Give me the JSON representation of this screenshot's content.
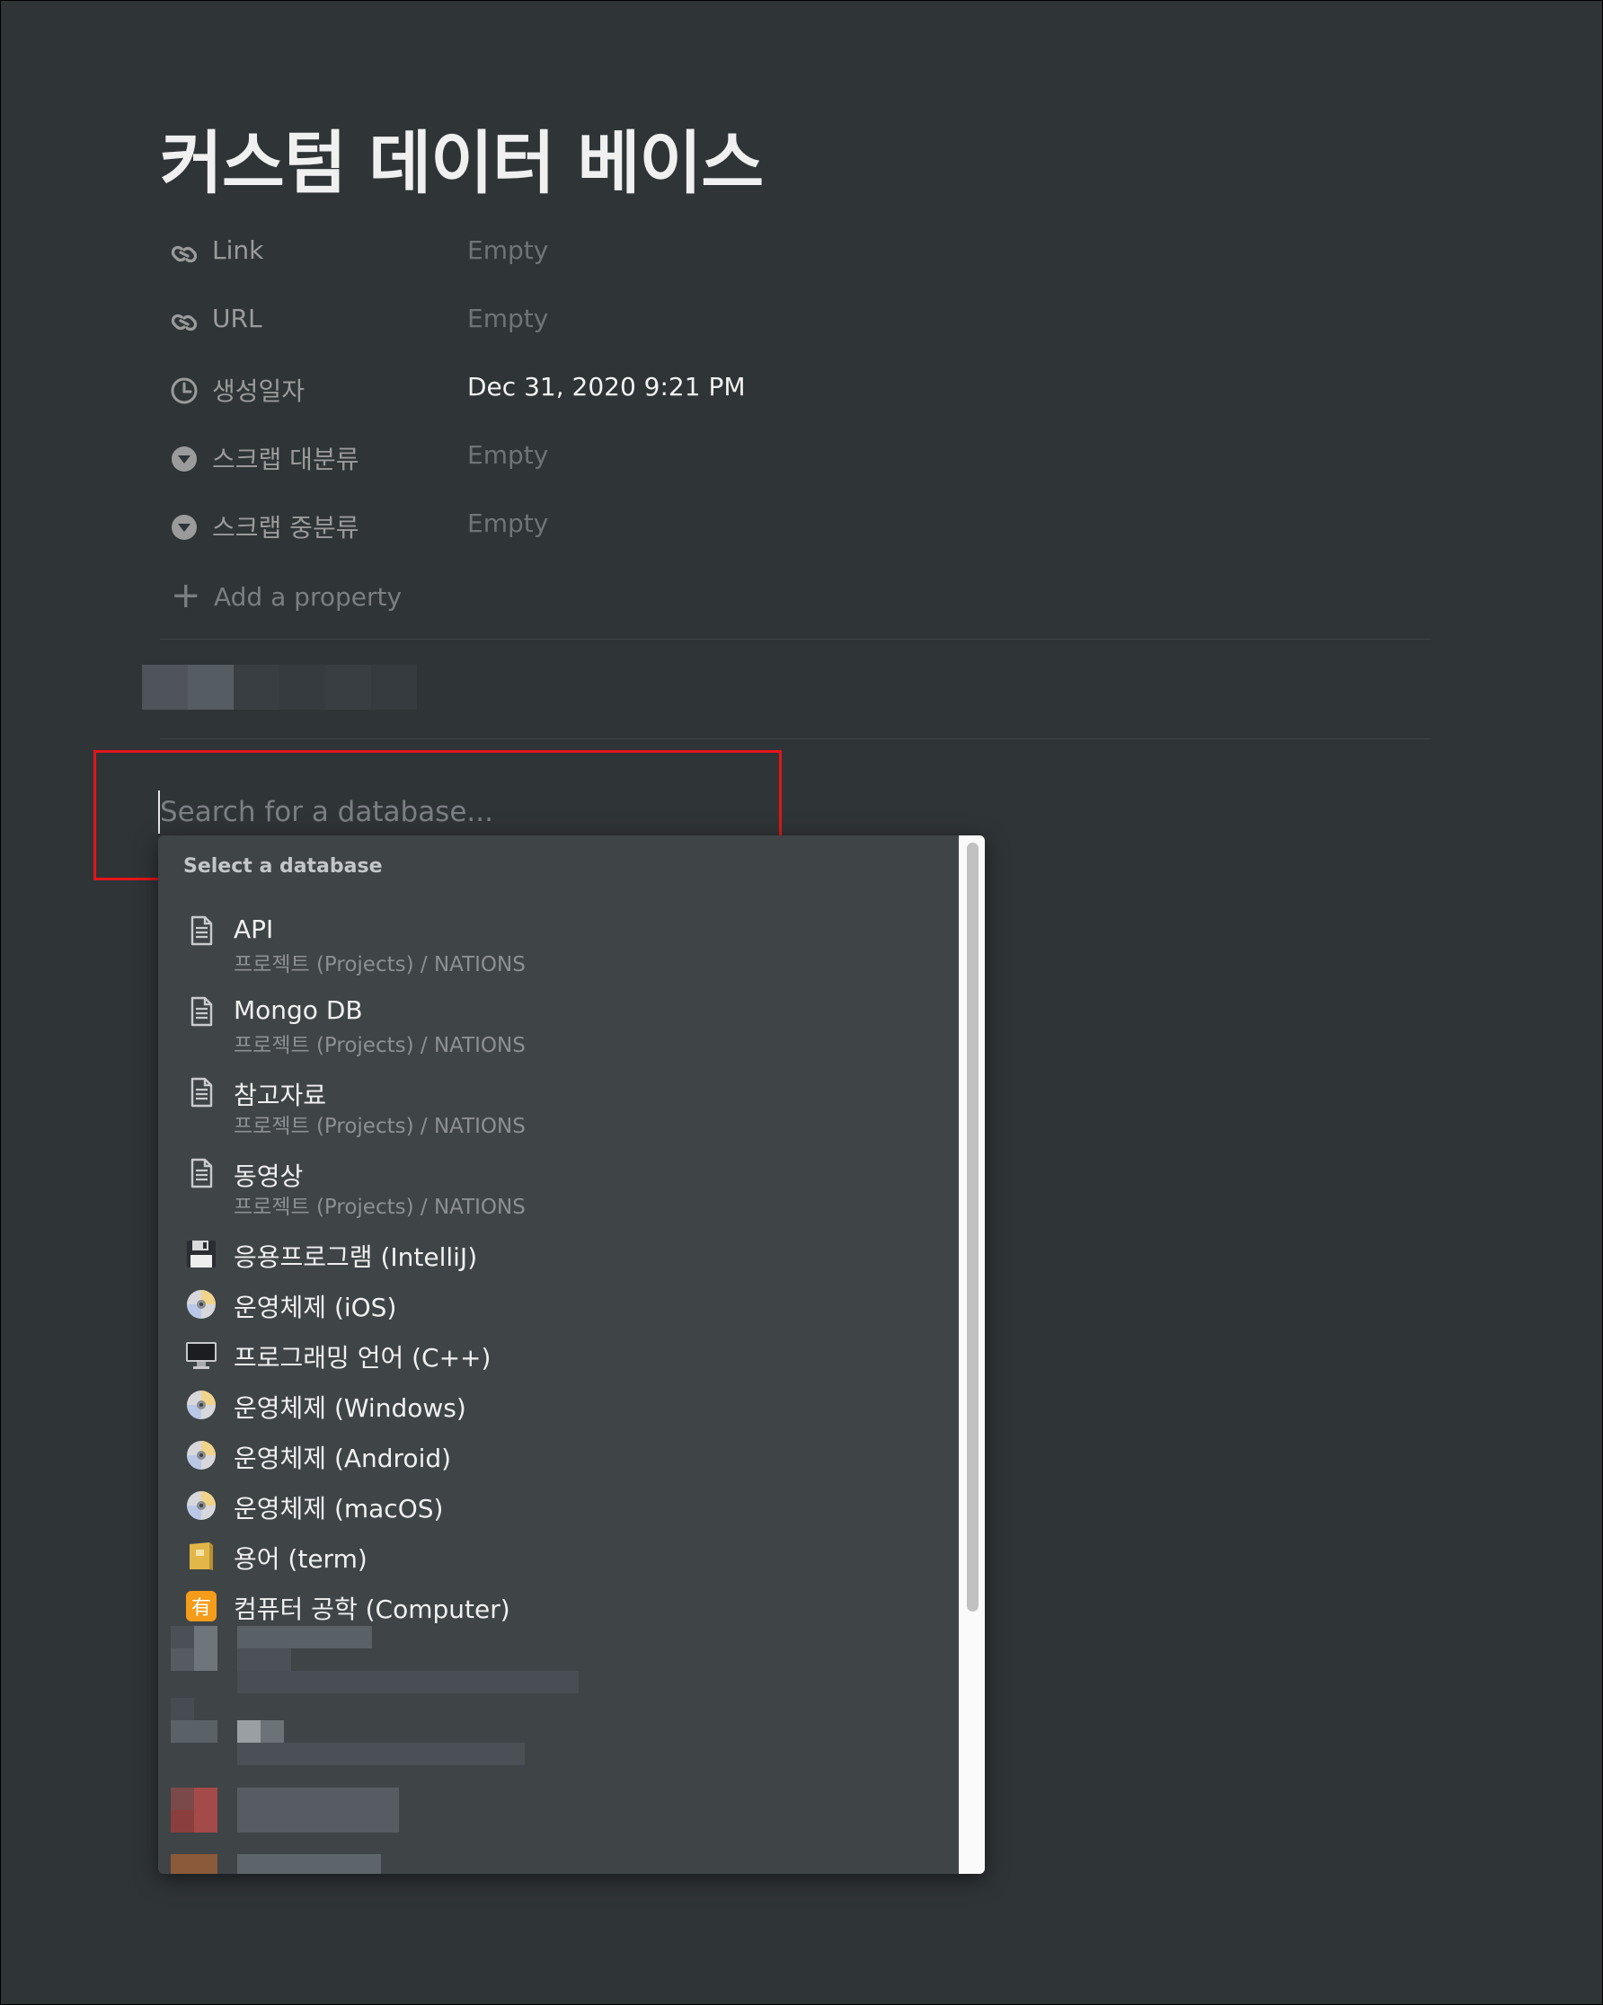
{
  "page": {
    "title": "커스텀 데이터 베이스"
  },
  "properties": [
    {
      "icon": "link-icon",
      "name": "Link",
      "value": "Empty",
      "filled": false
    },
    {
      "icon": "link-icon",
      "name": "URL",
      "value": "Empty",
      "filled": false
    },
    {
      "icon": "clock-icon",
      "name": "생성일자",
      "value": "Dec 31, 2020 9:21 PM",
      "filled": true
    },
    {
      "icon": "select-icon",
      "name": "스크랩 대분류",
      "value": "Empty",
      "filled": false
    },
    {
      "icon": "select-icon",
      "name": "스크랩 중분류",
      "value": "Empty",
      "filled": false
    }
  ],
  "add_property": {
    "label": "Add a property"
  },
  "search": {
    "placeholder": "Search for a database..."
  },
  "dropdown": {
    "header": "Select a database",
    "pages": [
      {
        "icon": "page-icon",
        "name": "API",
        "path": "프로젝트 (Projects) / NATIONS"
      },
      {
        "icon": "page-icon",
        "name": "Mongo DB",
        "path": "프로젝트 (Projects) / NATIONS"
      },
      {
        "icon": "page-icon",
        "name": "참고자료",
        "path": "프로젝트 (Projects) / NATIONS"
      },
      {
        "icon": "page-icon",
        "name": "동영상",
        "path": "프로젝트 (Projects) / NATIONS"
      }
    ],
    "databases": [
      {
        "icon": "floppy-disk-icon",
        "name": "응용프로그램 (IntelliJ)"
      },
      {
        "icon": "optical-disc-icon",
        "name": "운영체제 (iOS)"
      },
      {
        "icon": "desktop-computer-icon",
        "name": "프로그래밍 언어 (C++)"
      },
      {
        "icon": "optical-disc-icon",
        "name": "운영체제 (Windows)"
      },
      {
        "icon": "optical-disc-icon",
        "name": "운영체제 (Android)"
      },
      {
        "icon": "optical-disc-icon",
        "name": "운영체제 (macOS)"
      },
      {
        "icon": "yellow-book-icon",
        "name": "용어 (term)"
      },
      {
        "icon": "kanji-have-icon",
        "name": "컴퓨터 공학 (Computer)"
      }
    ]
  }
}
